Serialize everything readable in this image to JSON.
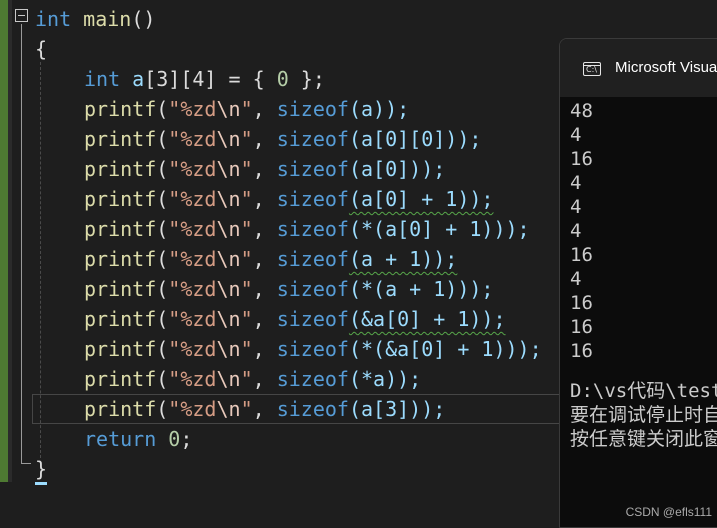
{
  "editor": {
    "signature": {
      "kw": "int",
      "name": "main",
      "parens": "()"
    },
    "open_brace": "{",
    "close_brace": "}",
    "decl": {
      "kw": "int",
      "var": "a",
      "dims": "[3][4]",
      "rest": " = { ",
      "zero": "0",
      "end": " };"
    },
    "printf_name": "printf",
    "fmt_open": "\"%zd",
    "fmt_esc": "\\n",
    "fmt_close": "\"",
    "sizeof_kw": "sizeof",
    "args": [
      "(a));",
      "(a[0][0]));",
      "(a[0]));",
      "(a[0] + 1));",
      "(*(a[0] + 1)));",
      "(a + 1));",
      "(*(a + 1)));",
      "(&a[0] + 1));",
      "(*(&a[0] + 1)));",
      "(*a));",
      "(a[3]));"
    ],
    "return_kw": "return",
    "return_val": "0",
    "return_end": ";"
  },
  "console": {
    "title": "Microsoft Visual Studio Debug Console",
    "output": [
      "48",
      "4",
      "16",
      "4",
      "4",
      "4",
      "16",
      "4",
      "16",
      "16",
      "16"
    ],
    "path_line": "D:\\vs代码\\test",
    "msg1": "要在调试停止时自动关闭控制台",
    "msg2": "按任意键关闭此窗口"
  },
  "watermark": "CSDN @efls111"
}
